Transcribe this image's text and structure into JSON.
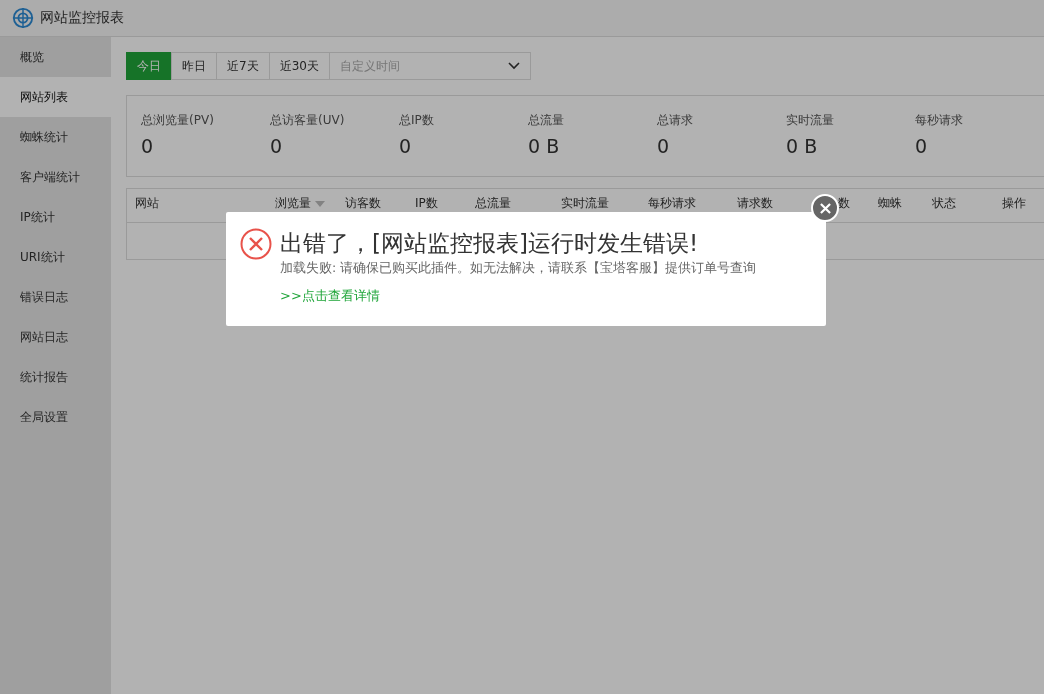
{
  "window": {
    "title": "网站监控报表"
  },
  "sidebar": {
    "items": [
      {
        "label": "概览",
        "selected": false
      },
      {
        "label": "网站列表",
        "selected": true
      },
      {
        "label": "蜘蛛统计",
        "selected": false
      },
      {
        "label": "客户端统计",
        "selected": false
      },
      {
        "label": "IP统计",
        "selected": false
      },
      {
        "label": "URI统计",
        "selected": false
      },
      {
        "label": "错误日志",
        "selected": false
      },
      {
        "label": "网站日志",
        "selected": false
      },
      {
        "label": "统计报告",
        "selected": false
      },
      {
        "label": "全局设置",
        "selected": false
      }
    ]
  },
  "range_tabs": [
    {
      "label": "今日",
      "selected": true
    },
    {
      "label": "昨日",
      "selected": false
    },
    {
      "label": "近7天",
      "selected": false
    },
    {
      "label": "近30天",
      "selected": false
    }
  ],
  "custom_time": {
    "placeholder": "自定义时间"
  },
  "stats": [
    {
      "label": "总浏览量(PV)",
      "value": "0"
    },
    {
      "label": "总访客量(UV)",
      "value": "0"
    },
    {
      "label": "总IP数",
      "value": "0"
    },
    {
      "label": "总流量",
      "value": "0 B"
    },
    {
      "label": "总请求",
      "value": "0"
    },
    {
      "label": "实时流量",
      "value": "0 B"
    },
    {
      "label": "每秒请求",
      "value": "0"
    }
  ],
  "table": {
    "columns": [
      {
        "label": "网站",
        "sorted": false
      },
      {
        "label": "浏览量",
        "sorted": true
      },
      {
        "label": "访客数",
        "sorted": false
      },
      {
        "label": "IP数",
        "sorted": false
      },
      {
        "label": "总流量",
        "sorted": false
      },
      {
        "label": "实时流量",
        "sorted": false
      },
      {
        "label": "每秒请求",
        "sorted": false
      },
      {
        "label": "请求数",
        "sorted": false
      },
      {
        "label": "数",
        "sorted": false
      },
      {
        "label": "蜘蛛",
        "sorted": false
      },
      {
        "label": "状态",
        "sorted": false
      },
      {
        "label": "操作",
        "sorted": false
      }
    ]
  },
  "dialog": {
    "title": "出错了，[网站监控报表]运行时发生错误!",
    "message": "加载失败: 请确保已购买此插件。如无法解决，请联系【宝塔客服】提供订单号查询",
    "link": ">>点击查看详情"
  }
}
